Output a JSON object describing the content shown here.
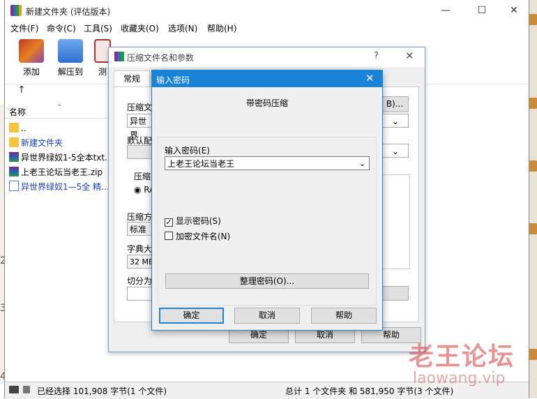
{
  "window": {
    "title": "新建文件夹 (评估版本)",
    "controls": {
      "minimize": "—",
      "maximize": "☐",
      "close": "✕"
    }
  },
  "menu": [
    "文件(F)",
    "命令(C)",
    "工具(S)",
    "收藏夹(O)",
    "选项(N)",
    "帮助(H)"
  ],
  "toolbar": [
    {
      "label": "添加",
      "icon": "add-archive-icon",
      "color": "#c0392b"
    },
    {
      "label": "解压到",
      "icon": "extract-folder-icon",
      "color": "#3a7bd5"
    },
    {
      "label": "测",
      "icon": "test-icon",
      "color": "#b03030"
    }
  ],
  "file_list": {
    "column_name": "名称",
    "items": [
      {
        "name": "..",
        "type": "folder"
      },
      {
        "name": "新建文件夹",
        "type": "folder"
      },
      {
        "name": "异世界绿奴1-5全本txt.",
        "type": "archive"
      },
      {
        "name": "上老王论坛当老王.zip",
        "type": "archive"
      },
      {
        "name": "异世界绿奴1—5全 精…",
        "type": "text"
      }
    ]
  },
  "status": {
    "left": "已经选择 101,908 字节(1 个文件)",
    "right": "总计 1 个文件夹 和 581,950 字节(3 个文件)"
  },
  "archive_dialog": {
    "title": "压缩文件名和参数",
    "help_glyph": "?",
    "close_glyph": "✕",
    "tab": "常规",
    "archive_name_label": "压缩文",
    "archive_name_value": "异世界",
    "browse_button": "B)...",
    "profile_label": "默认配",
    "format_label": "压缩",
    "format_radio": "RA",
    "method_label": "压缩方",
    "method_value": "标准",
    "dict_label": "字典大",
    "dict_value": "32 MB",
    "split_label": "切分为",
    "ok": "确定",
    "cancel": "取消",
    "help": "帮助"
  },
  "password_dialog": {
    "title": "输入密码",
    "close_glyph": "✕",
    "heading": "带密码压缩",
    "password_label": "输入密码(E)",
    "password_value": "上老王论坛当老王",
    "show_password": {
      "label": "显示密码(S)",
      "checked": true
    },
    "encrypt_names": {
      "label": "加密文件名(N)",
      "checked": false
    },
    "organize_button": "整理密码(O)...",
    "ok": "确定",
    "cancel": "取消",
    "help": "帮助"
  },
  "watermark": {
    "line1": "老王论坛",
    "line2": "laowang.vip"
  },
  "desktop_numbers": [
    "2",
    "3",
    "4"
  ]
}
